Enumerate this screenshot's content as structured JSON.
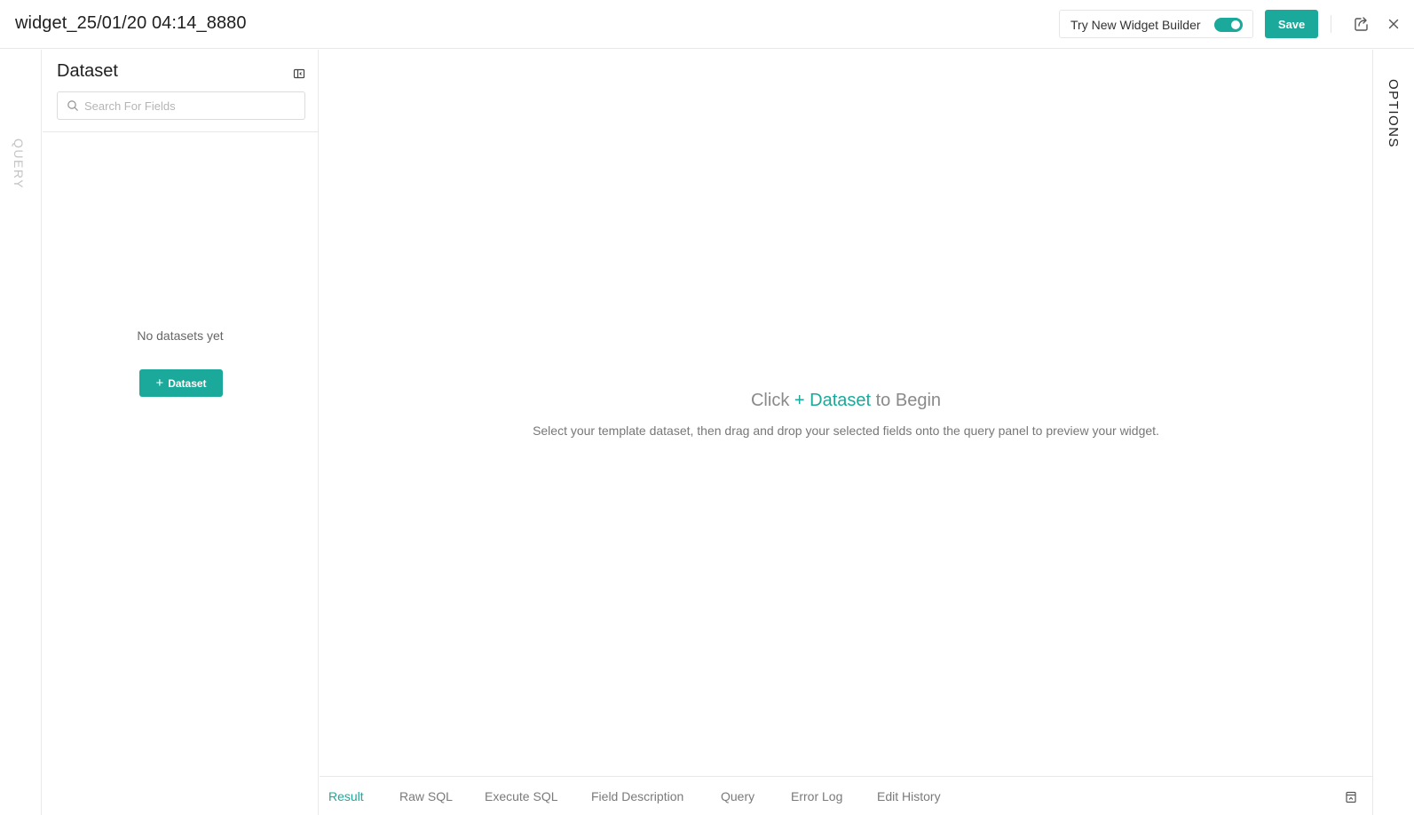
{
  "header": {
    "title": "widget_25/01/20 04:14_8880",
    "try_new_label": "Try New Widget Builder",
    "save_label": "Save",
    "icons": {
      "share": "share-icon",
      "close": "close-icon"
    }
  },
  "left_rail": {
    "label": "QUERY"
  },
  "dataset_panel": {
    "title": "Dataset",
    "search_placeholder": "Search For Fields",
    "empty_text": "No datasets yet",
    "add_button_label": "Dataset"
  },
  "main": {
    "prompt_prefix": "Click",
    "prompt_accent": "+ Dataset",
    "prompt_suffix": "to Begin",
    "subtitle": "Select your template dataset, then drag and drop your selected fields onto the query panel to preview your widget."
  },
  "tabs": [
    {
      "label": "Result",
      "active": true
    },
    {
      "label": "Raw SQL",
      "active": false
    },
    {
      "label": "Execute SQL",
      "active": false
    },
    {
      "label": "Field Description",
      "active": false
    },
    {
      "label": "Query",
      "active": false
    },
    {
      "label": "Error Log",
      "active": false
    },
    {
      "label": "Edit History",
      "active": false
    }
  ],
  "right_rail": {
    "label": "OPTIONS"
  },
  "colors": {
    "accent": "#1aa99a",
    "border": "#e8e8e8"
  }
}
